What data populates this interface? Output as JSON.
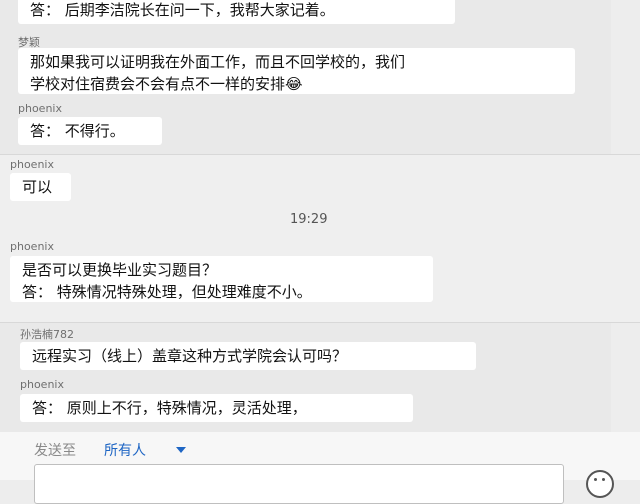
{
  "messages": [
    {
      "sender": "",
      "text": "答：  后期李洁院长在问一下，我帮大家记着。"
    },
    {
      "sender": "梦颖",
      "lines": [
        "那如果我可以证明我在外面工作，而且不回学校的，我们",
        "学校对住宿费会不会有点不一样的安排😂"
      ]
    },
    {
      "sender": "phoenix",
      "text": "答：  不得行。"
    },
    {
      "sender": "phoenix",
      "text": "可以"
    },
    {
      "timestamp": "19:29"
    },
    {
      "sender": "phoenix",
      "lines": [
        "是否可以更换毕业实习题目？",
        "答：  特殊情况特殊处理，但处理难度不小。"
      ]
    },
    {
      "sender": "孙浩楠782",
      "text": "远程实习（线上）盖章这种方式学院会认可吗？"
    },
    {
      "sender": "phoenix",
      "text": "答：  原则上不行，特殊情况，灵活处理，"
    }
  ],
  "composer": {
    "send_to_label": "发送至",
    "recipient": "所有人",
    "input_placeholder": ""
  },
  "icons": {
    "recipient_dropdown": "caret-down-icon",
    "emoji_button": "smiley-icon"
  }
}
